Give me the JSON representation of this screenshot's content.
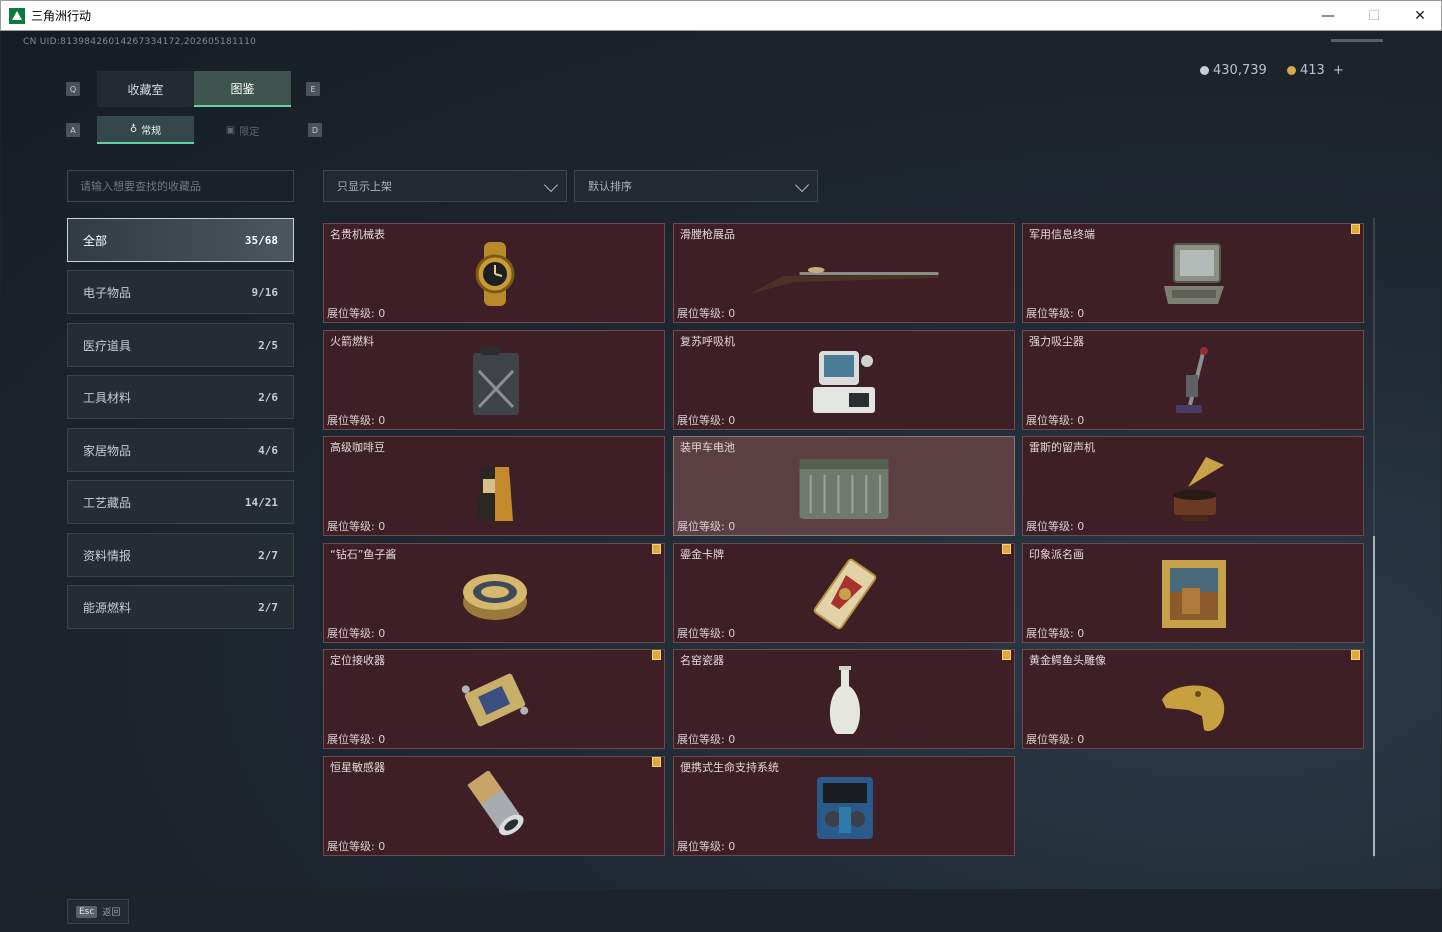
{
  "window": {
    "title": "三角洲行动",
    "minimize": "—",
    "maximize": "☐",
    "close": "✕"
  },
  "header": {
    "uid": "CN UID:8139842601426733417​2,202605181110",
    "silver": "430,739",
    "gold": "413",
    "plus": "+"
  },
  "keys": {
    "q": "Q",
    "e": "E",
    "a": "A",
    "d": "D"
  },
  "tabs": [
    "收藏室",
    "图鉴"
  ],
  "subtabs": [
    "常规",
    "限定"
  ],
  "search": {
    "placeholder": "请输入想要查找的收藏品"
  },
  "filters": {
    "shelf": "只显示上架",
    "sort": "默认排序"
  },
  "categories": [
    {
      "label": "全部",
      "count": "35/68"
    },
    {
      "label": "电子物品",
      "count": "9/16"
    },
    {
      "label": "医疗道具",
      "count": "2/5"
    },
    {
      "label": "工具材料",
      "count": "2/6"
    },
    {
      "label": "家居物品",
      "count": "4/6"
    },
    {
      "label": "工艺藏品",
      "count": "14/21"
    },
    {
      "label": "资料情报",
      "count": "2/7"
    },
    {
      "label": "能源燃料",
      "count": "2/7"
    }
  ],
  "items": [
    {
      "name": "名贵机械表",
      "level": "展位等级: 0",
      "icon": "gold-watch-icon"
    },
    {
      "name": "滑膛枪展品",
      "level": "展位等级: 0",
      "icon": "musket-icon"
    },
    {
      "name": "军用信息终端",
      "level": "展位等级: 0",
      "icon": "laptop-case-icon"
    },
    {
      "name": "火箭燃料",
      "level": "展位等级: 0",
      "icon": "fuel-can-icon"
    },
    {
      "name": "复苏呼吸机",
      "level": "展位等级: 0",
      "icon": "ventilator-icon"
    },
    {
      "name": "强力吸尘器",
      "level": "展位等级: 0",
      "icon": "vacuum-icon"
    },
    {
      "name": "高级咖啡豆",
      "level": "展位等级: 0",
      "icon": "coffee-bag-icon"
    },
    {
      "name": "装甲车电池",
      "level": "展位等级: 0",
      "icon": "battery-icon"
    },
    {
      "name": "雷斯的留声机",
      "level": "展位等级: 0",
      "icon": "gramophone-icon"
    },
    {
      "name": "“钻石”鱼子酱",
      "level": "展位等级: 0",
      "icon": "caviar-tin-icon"
    },
    {
      "name": "鎏金卡牌",
      "level": "展位等级: 0",
      "icon": "gilded-card-icon"
    },
    {
      "name": "印象派名画",
      "level": "展位等级: 0",
      "icon": "painting-icon"
    },
    {
      "name": "定位接收器",
      "level": "展位等级: 0",
      "icon": "receiver-icon"
    },
    {
      "name": "名窑瓷器",
      "level": "展位等级: 0",
      "icon": "porcelain-vase-icon"
    },
    {
      "name": "黄金鳄鱼头雕像",
      "level": "展位等级: 0",
      "icon": "crocodile-statue-icon"
    },
    {
      "name": "恒星敏感器",
      "level": "展位等级: 0",
      "icon": "star-sensor-icon"
    },
    {
      "name": "便携式生命支持系统",
      "level": "展位等级: 0",
      "icon": "life-support-icon"
    }
  ],
  "footer": {
    "esc_key": "Esc",
    "esc_label": "返回"
  }
}
